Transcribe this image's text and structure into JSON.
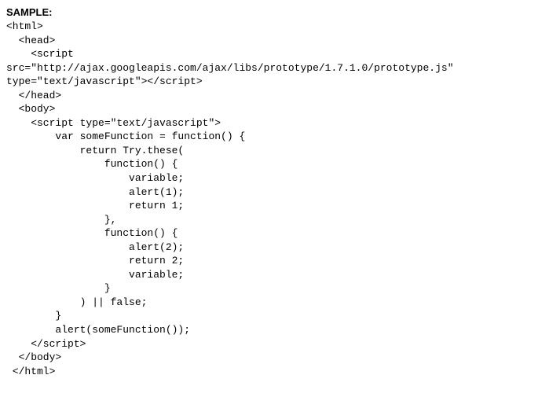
{
  "heading": "SAMPLE:",
  "code": "<html>\n  <head>\n    <script\nsrc=\"http://ajax.googleapis.com/ajax/libs/prototype/1.7.1.0/prototype.js\"\ntype=\"text/javascript\"></script>\n  </head>\n  <body>\n    <script type=\"text/javascript\">\n        var someFunction = function() {\n            return Try.these(\n                function() {\n                    variable;\n                    alert(1);\n                    return 1;\n                },\n                function() {\n                    alert(2);\n                    return 2;\n                    variable;\n                }\n            ) || false;\n        }\n        alert(someFunction());\n    </script>\n  </body>\n </html>"
}
